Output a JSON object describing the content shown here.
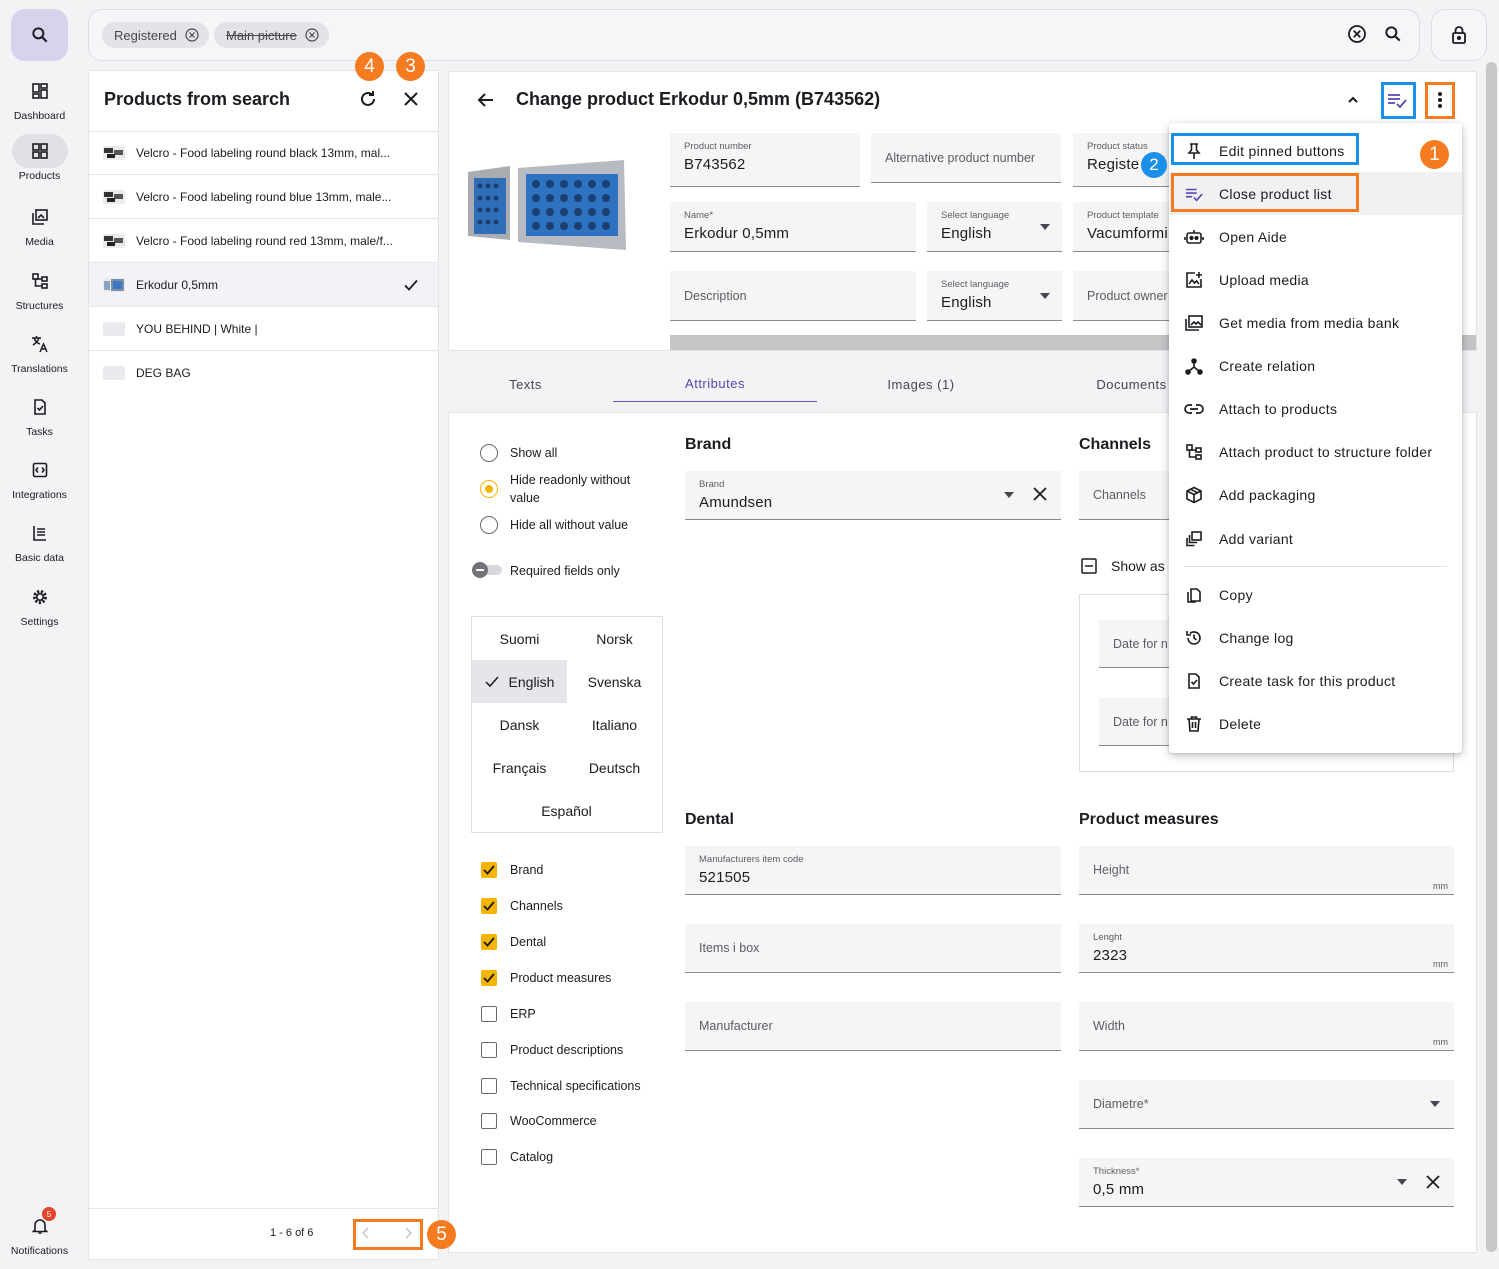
{
  "rail": {
    "items": [
      {
        "label": "Dashboard",
        "icon": "dashboard-icon"
      },
      {
        "label": "Products",
        "icon": "products-icon"
      },
      {
        "label": "Media",
        "icon": "media-icon"
      },
      {
        "label": "Structures",
        "icon": "structures-icon"
      },
      {
        "label": "Translations",
        "icon": "translate-icon"
      },
      {
        "label": "Tasks",
        "icon": "tasks-icon"
      },
      {
        "label": "Integrations",
        "icon": "integrations-icon"
      },
      {
        "label": "Basic data",
        "icon": "basic-data-icon"
      },
      {
        "label": "Settings",
        "icon": "gear-icon"
      }
    ],
    "notifications": {
      "label": "Notifications",
      "count": "5"
    }
  },
  "search": {
    "chips": [
      {
        "label": "Registered",
        "struck": false
      },
      {
        "label": "Main picture",
        "struck": true
      }
    ]
  },
  "product_list": {
    "title": "Products from search",
    "items": [
      {
        "name": "Velcro - Food labeling round black 13mm, mal...",
        "selected": false
      },
      {
        "name": "Velcro - Food labeling round blue 13mm, male...",
        "selected": false
      },
      {
        "name": "Velcro - Food labeling round red 13mm, male/f...",
        "selected": false
      },
      {
        "name": "Erkodur 0,5mm",
        "selected": true
      },
      {
        "name": "YOU BEHIND | White |",
        "selected": false
      },
      {
        "name": "DEG BAG",
        "selected": false
      }
    ],
    "pagination": "1 - 6 of 6"
  },
  "annotations": [
    "1",
    "2",
    "3",
    "4",
    "5"
  ],
  "header": {
    "title": "Change product Erkodur 0,5mm (B743562)"
  },
  "fields": {
    "product_number": {
      "label": "Product number",
      "value": "B743562"
    },
    "alt_product_number": {
      "placeholder": "Alternative product number"
    },
    "product_status": {
      "label": "Product status",
      "value": "Registe"
    },
    "name": {
      "label": "Name*",
      "value": "Erkodur 0,5mm"
    },
    "language1": {
      "label": "Select language",
      "value": "English"
    },
    "product_template": {
      "label": "Product template",
      "value": "Vacumformi"
    },
    "description": {
      "placeholder": "Description"
    },
    "language2": {
      "label": "Select language",
      "value": "English"
    },
    "product_owner": {
      "placeholder": "Product owner"
    }
  },
  "tabs": [
    "Texts",
    "Attributes",
    "Images (1)",
    "Documents"
  ],
  "filters": {
    "radios": [
      {
        "label": "Show all",
        "checked": false
      },
      {
        "label": "Hide readonly without value",
        "checked": true
      },
      {
        "label": "Hide all without value",
        "checked": false
      }
    ],
    "required_toggle": "Required fields only",
    "languages": [
      "Suomi",
      "Norsk",
      "English",
      "Svenska",
      "Dansk",
      "Italiano",
      "Français",
      "Deutsch",
      "Español"
    ],
    "selected_language": "English",
    "groups": [
      {
        "label": "Brand",
        "checked": true
      },
      {
        "label": "Channels",
        "checked": true
      },
      {
        "label": "Dental",
        "checked": true
      },
      {
        "label": "Product measures",
        "checked": true
      },
      {
        "label": "ERP",
        "checked": false
      },
      {
        "label": "Product descriptions",
        "checked": false
      },
      {
        "label": "Technical specifications",
        "checked": false
      },
      {
        "label": "WooCommerce",
        "checked": false
      },
      {
        "label": "Catalog",
        "checked": false
      }
    ]
  },
  "sections": {
    "brand": {
      "title": "Brand",
      "field_label": "Brand",
      "value": "Amundsen"
    },
    "channels": {
      "title": "Channels",
      "placeholder": "Channels",
      "show_as": "Show as",
      "date1": "Date for n",
      "date2": "Date for n"
    },
    "dental": {
      "title": "Dental",
      "mfr_code_label": "Manufacturers item code",
      "mfr_code_value": "521505",
      "items_in_box": "Items i box",
      "manufacturer": "Manufacturer"
    },
    "measures": {
      "title": "Product measures",
      "height": "Height",
      "length_label": "Lenght",
      "length_value": "2323",
      "width": "Width",
      "diametre": "Diametre*",
      "thickness_label": "Thickness*",
      "thickness_value": "0,5 mm",
      "unit": "mm"
    }
  },
  "menu": {
    "items": [
      {
        "label": "Edit pinned buttons",
        "icon": "pin-icon"
      },
      {
        "label": "Close product list",
        "icon": "playlist-check-icon"
      },
      {
        "label": "Open Aide",
        "icon": "robot-icon"
      },
      {
        "label": "Upload media",
        "icon": "image-plus-icon"
      },
      {
        "label": "Get media from media bank",
        "icon": "image-multiple-icon"
      },
      {
        "label": "Create relation",
        "icon": "relation-icon"
      },
      {
        "label": "Attach to products",
        "icon": "link-icon"
      },
      {
        "label": "Attach product to structure folder",
        "icon": "structure-icon"
      },
      {
        "label": "Add packaging",
        "icon": "package-icon"
      },
      {
        "label": "Add variant",
        "icon": "variant-icon"
      },
      {
        "label": "Copy",
        "icon": "copy-icon"
      },
      {
        "label": "Change log",
        "icon": "history-icon"
      },
      {
        "label": "Create task for this product",
        "icon": "task-icon"
      },
      {
        "label": "Delete",
        "icon": "trash-icon"
      }
    ]
  },
  "colors": {
    "accent": "#6a53c4",
    "highlight_orange": "#f47b20",
    "highlight_blue": "#1c8fe8",
    "checkbox": "#f5b400"
  }
}
